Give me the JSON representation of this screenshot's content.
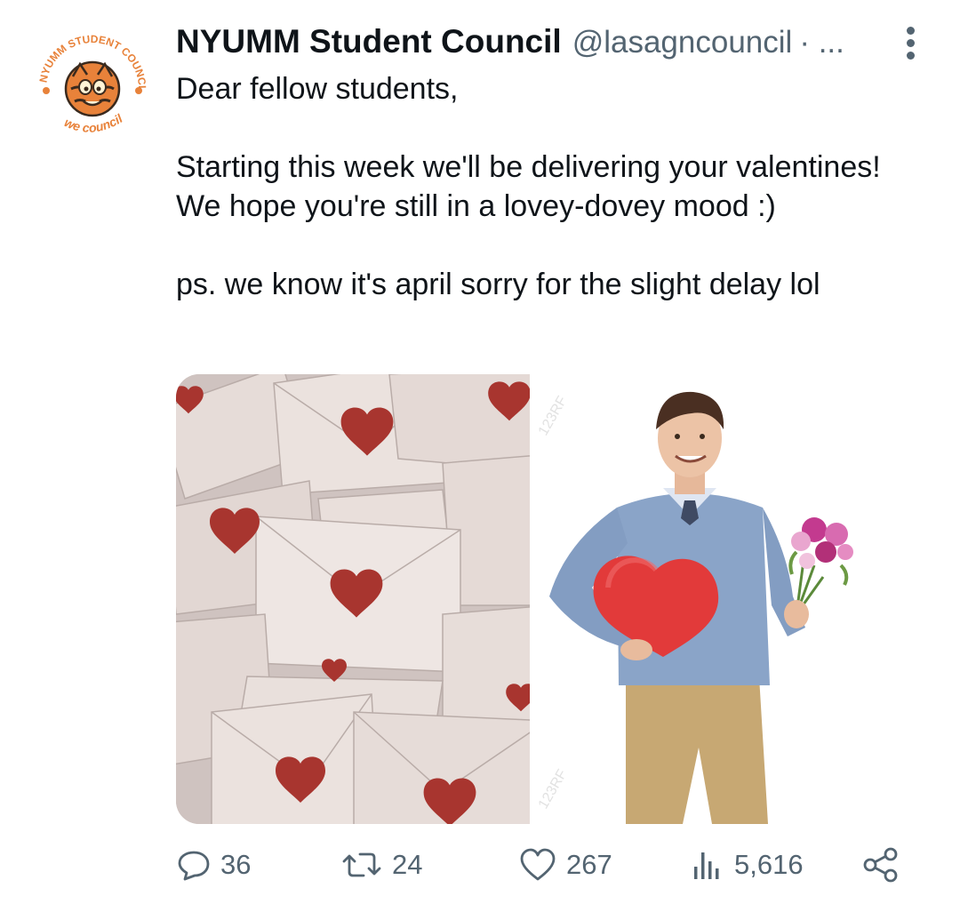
{
  "tweet": {
    "author_name": "NYUMM Student Council",
    "handle": "@lasagncouncil",
    "meta_separator": "· ...",
    "avatar_ring_text": "NYUMM STUDENT COUNCIL",
    "avatar_bottom_text": "we council",
    "paragraphs": [
      "Dear fellow students,",
      "Starting this week we'll be delivering your valentines! We hope you're still in a lovey-dovey mood :)",
      "ps. we know it's april sorry for the slight delay lol"
    ],
    "media_watermark": "123RF"
  },
  "actions": {
    "replies": "36",
    "retweets": "24",
    "likes": "267",
    "views": "5,616"
  },
  "colors": {
    "text": "#0f1419",
    "secondary": "#536471",
    "avatar_orange": "#e8823a",
    "heart_red": "#a8352f",
    "envelope": "#e7dcd8"
  }
}
